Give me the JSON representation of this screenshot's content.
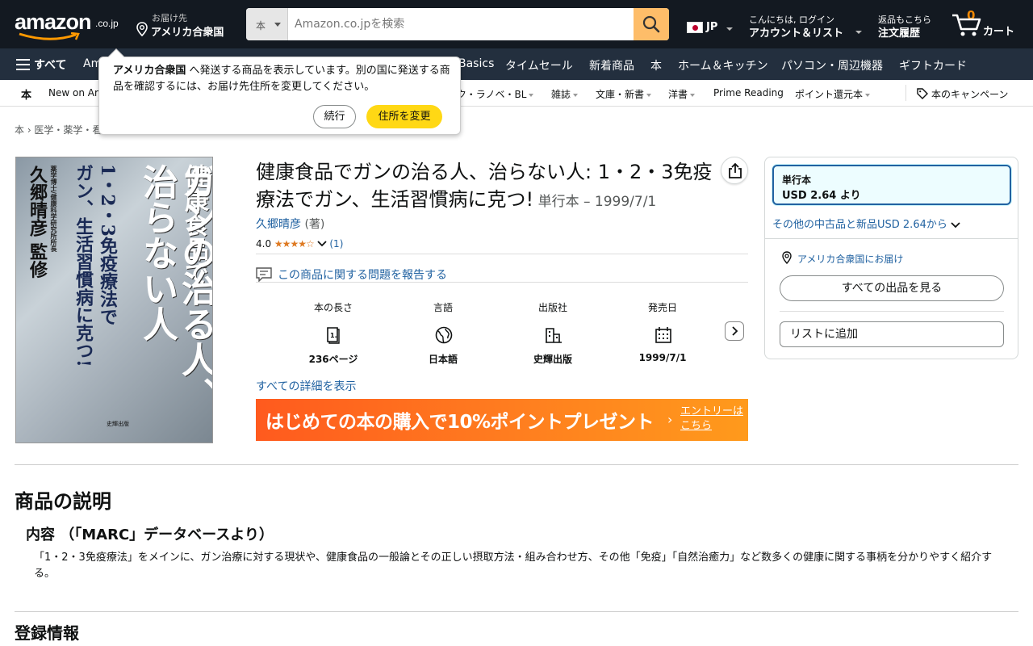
{
  "header": {
    "logo_text": "amazon",
    "logo_suffix": ".co.jp",
    "deliver_line1": "お届け先",
    "deliver_line2": "アメリカ合衆国",
    "search_category": "本",
    "search_placeholder": "Amazon.co.jpを検索",
    "language": "JP",
    "account_line1": "こんにちは, ログイン",
    "account_line2": "アカウント＆リスト",
    "orders_line1": "返品もこちら",
    "orders_line2": "注文履歴",
    "cart_count": "0",
    "cart_label": "カート"
  },
  "main_nav": {
    "all_label": "すべて",
    "items": [
      "Am",
      "Basics",
      "タイムセール",
      "新着商品",
      "本",
      "ホーム＆キッチン",
      "パソコン・周辺機器",
      "ギフトカード"
    ]
  },
  "sub_nav": {
    "items": [
      "本",
      "New on Am",
      "ク・ラノベ・BL",
      "雑誌",
      "文庫・新書",
      "洋書",
      "Prime Reading",
      "ポイント還元本",
      "本のキャンペーン"
    ]
  },
  "popover": {
    "country": "アメリカ合衆国",
    "message": " へ発送する商品を表示しています。別の国に発送する商品を確認するには、お届け先住所を変更してください。",
    "continue_label": "続行",
    "change_label": "住所を変更"
  },
  "breadcrumb": "本 › 医学・薬学・看",
  "cover": {
    "line1": "健康食品で",
    "line2": "ガンの治る人、",
    "line3": "治らない人",
    "line4": "1・2・3免疫療法で",
    "line5": "ガン、生活習慣病に克つ!",
    "editor": "久郷晴彦 監修",
    "editor_sub": "薬学博士/健康科学研究所所長",
    "publisher": "史輝出版"
  },
  "product": {
    "title": "健康食品でガンの治る人、治らない人: 1・2・3免疫療法でガン、生活習慣病に克つ!",
    "format_date": " 単行本 – 1999/7/1",
    "author": "久郷晴彦",
    "author_role": " (著)",
    "rating_value": "4.0",
    "rating_stars": "★★★★☆",
    "rating_count": "(1)",
    "report_label": "この商品に関する問題を報告する",
    "details_link": "すべての詳細を表示"
  },
  "attributes": [
    {
      "label": "本の長さ",
      "value": "236ページ"
    },
    {
      "label": "言語",
      "value": "日本語"
    },
    {
      "label": "出版社",
      "value": "史輝出版"
    },
    {
      "label": "発売日",
      "value": "1999/7/1"
    }
  ],
  "banner": {
    "text": "はじめての本の購入で10%ポイントプレゼント",
    "entry": "エントリーは こちら"
  },
  "buybox": {
    "format_name": "単行本",
    "format_price": "USD 2.64 より",
    "used_link": "その他の中古品と新品USD 2.64から",
    "ship_to": "アメリカ合衆国にお届け",
    "all_offers": "すべての出品を見る",
    "add_list": "リストに追加"
  },
  "description": {
    "heading": "商品の説明",
    "subheading": "内容 （「MARC」データベースより）",
    "body": "「1・2・3免疫療法」をメインに、ガン治療に対する現状や、健康食品の一般論とその正しい摂取方法・組み合わせ方、その他「免疫」「自然治癒力」など数多くの健康に関する事柄を分かりやすく紹介する。"
  },
  "registration_heading": "登録情報",
  "colors": {
    "nav_dark": "#131921",
    "nav_secondary": "#232f3e",
    "search_button": "#febd69",
    "link": "#2162a1",
    "primary_button": "#ffd814",
    "star": "#de7921",
    "cart_count": "#f08804"
  }
}
